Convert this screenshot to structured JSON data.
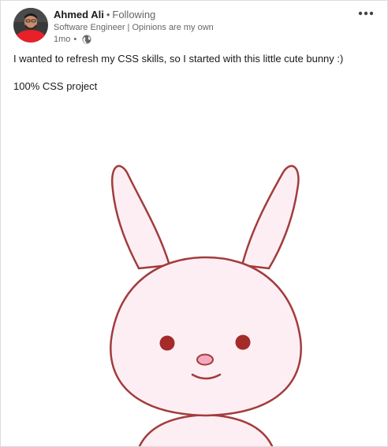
{
  "post": {
    "author": {
      "name": "Ahmed Ali",
      "separator": "•",
      "follow_status": "Following",
      "headline": "Software Engineer | Opinions are my own",
      "time": "1mo",
      "time_separator": "•",
      "visibility_icon": "globe-icon",
      "avatar_icon": "avatar"
    },
    "menu_icon": "more-options-icon",
    "text": {
      "line1": "I wanted to refresh my CSS skills, so I started with this little cute bunny :)",
      "line2": "100% CSS project"
    },
    "image": {
      "subject_icon": "bunny-illustration",
      "colors": {
        "fill": "#fdeef4",
        "outline": "#a23c3c",
        "eyes": "#a52a2a",
        "nose": "#f4a9bf"
      }
    }
  }
}
